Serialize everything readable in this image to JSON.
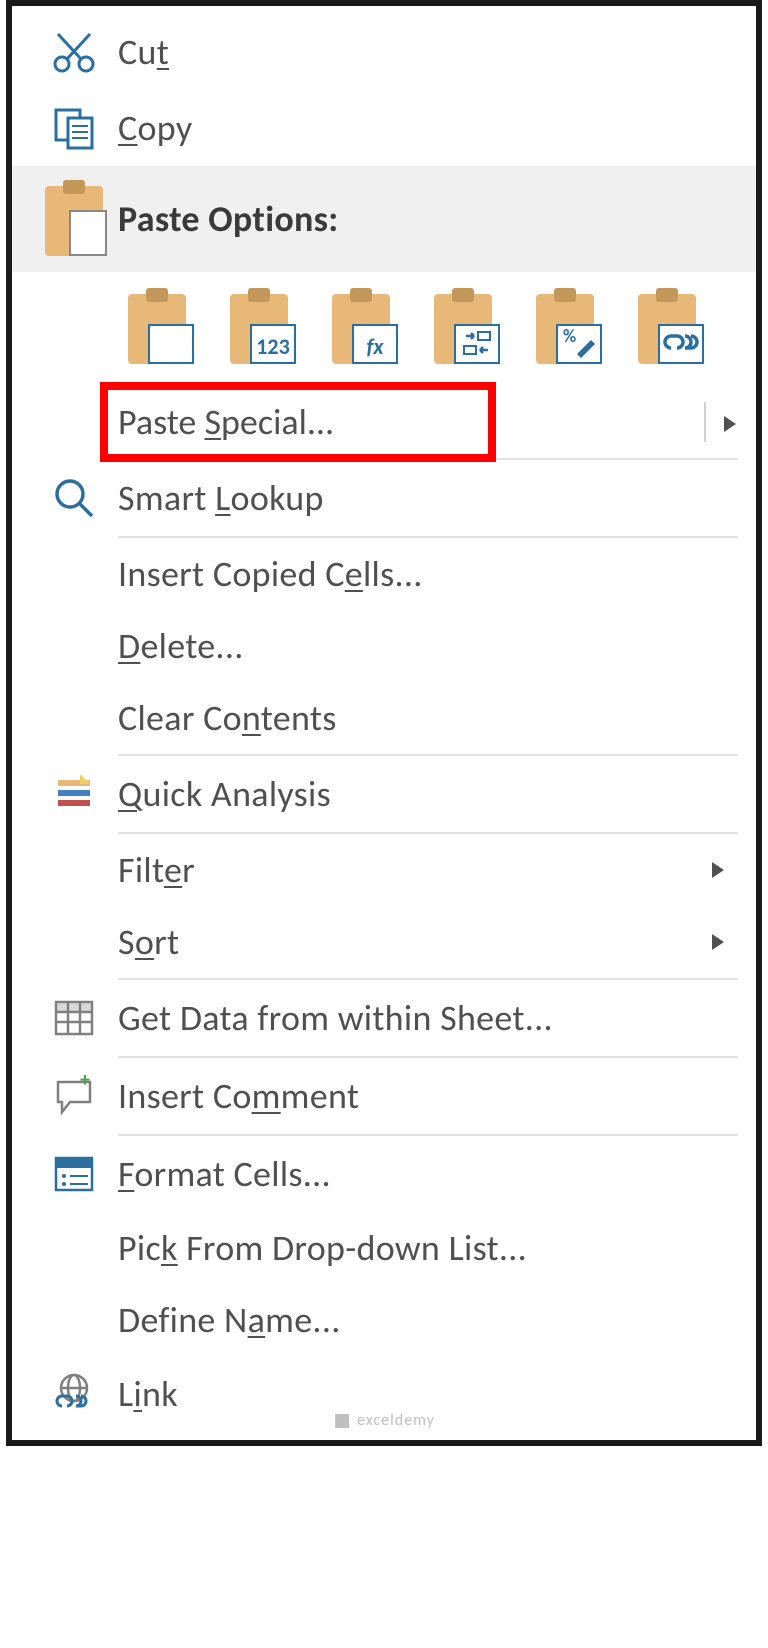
{
  "menu": {
    "cut": "Cut",
    "copy": "Copy",
    "pasteOptionsHeader": "Paste Options:",
    "pasteIcons": {
      "paste": "Paste",
      "values": "123",
      "formulas": "fx",
      "transpose": "⇄",
      "formatting": "%",
      "link": "∞"
    },
    "pasteSpecial": "Paste Special...",
    "smartLookup": "Smart Lookup",
    "insertCopiedCells": "Insert Copied Cells...",
    "delete": "Delete...",
    "clearContents": "Clear Contents",
    "quickAnalysis": "Quick Analysis",
    "filter": "Filter",
    "sort": "Sort",
    "getData": "Get Data from within Sheet...",
    "insertComment": "Insert Comment",
    "formatCells": "Format Cells...",
    "pickDropdown": "Pick From Drop-down List...",
    "defineName": "Define Name...",
    "link": "Link"
  },
  "watermark": "exceldemy"
}
